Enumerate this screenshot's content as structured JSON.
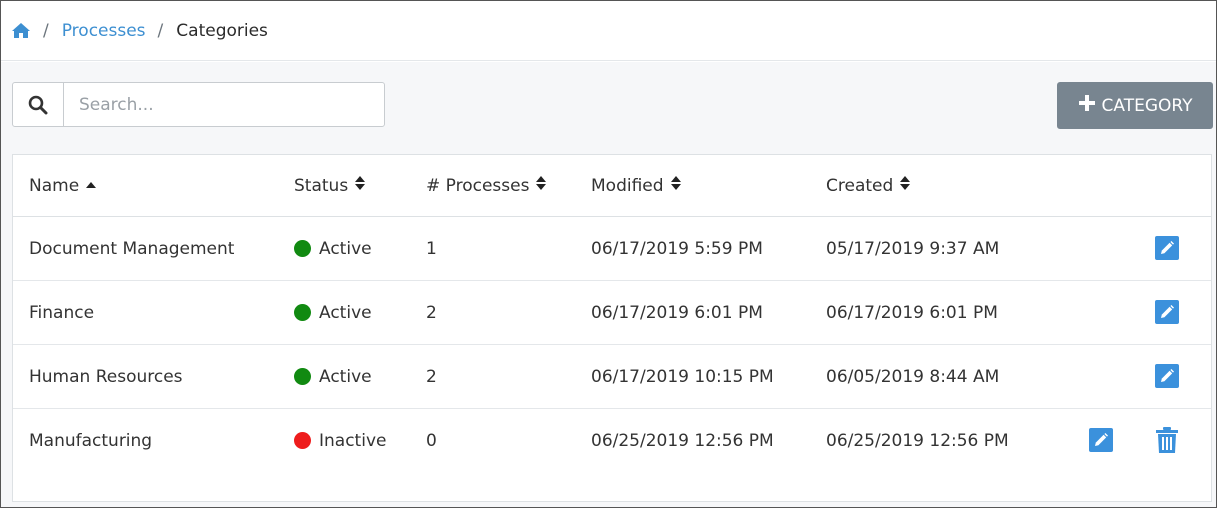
{
  "breadcrumb": {
    "items": [
      {
        "label": "Processes"
      },
      {
        "label": "Categories"
      }
    ],
    "separator": "/"
  },
  "search": {
    "placeholder": "Search...",
    "value": ""
  },
  "add_button": {
    "icon": "plus-icon",
    "label": "CATEGORY"
  },
  "table": {
    "columns": [
      {
        "label": "Name",
        "sort": "ascending"
      },
      {
        "label": "Status",
        "sort": "both"
      },
      {
        "label": "# Processes",
        "sort": "both"
      },
      {
        "label": "Modified",
        "sort": "both"
      },
      {
        "label": "Created",
        "sort": "both"
      }
    ],
    "rows": [
      {
        "name": "Document Management",
        "status": "Active",
        "processes": "1",
        "modified": "06/17/2019 5:59 PM",
        "created": "05/17/2019 9:37 AM"
      },
      {
        "name": "Finance",
        "status": "Active",
        "processes": "2",
        "modified": "06/17/2019 6:01 PM",
        "created": "06/17/2019 6:01 PM"
      },
      {
        "name": "Human Resources",
        "status": "Active",
        "processes": "2",
        "modified": "06/17/2019 10:15 PM",
        "created": "06/05/2019 8:44 AM"
      },
      {
        "name": "Manufacturing",
        "status": "Inactive",
        "processes": "0",
        "modified": "06/25/2019 12:56 PM",
        "created": "06/25/2019 12:56 PM"
      }
    ]
  },
  "colors": {
    "link": "#3d8fd1",
    "active": "#118a11",
    "inactive": "#ee1c1c",
    "action_button": "#788590",
    "edit_button": "#3b91dc",
    "delete_icon": "#3b91dc"
  }
}
